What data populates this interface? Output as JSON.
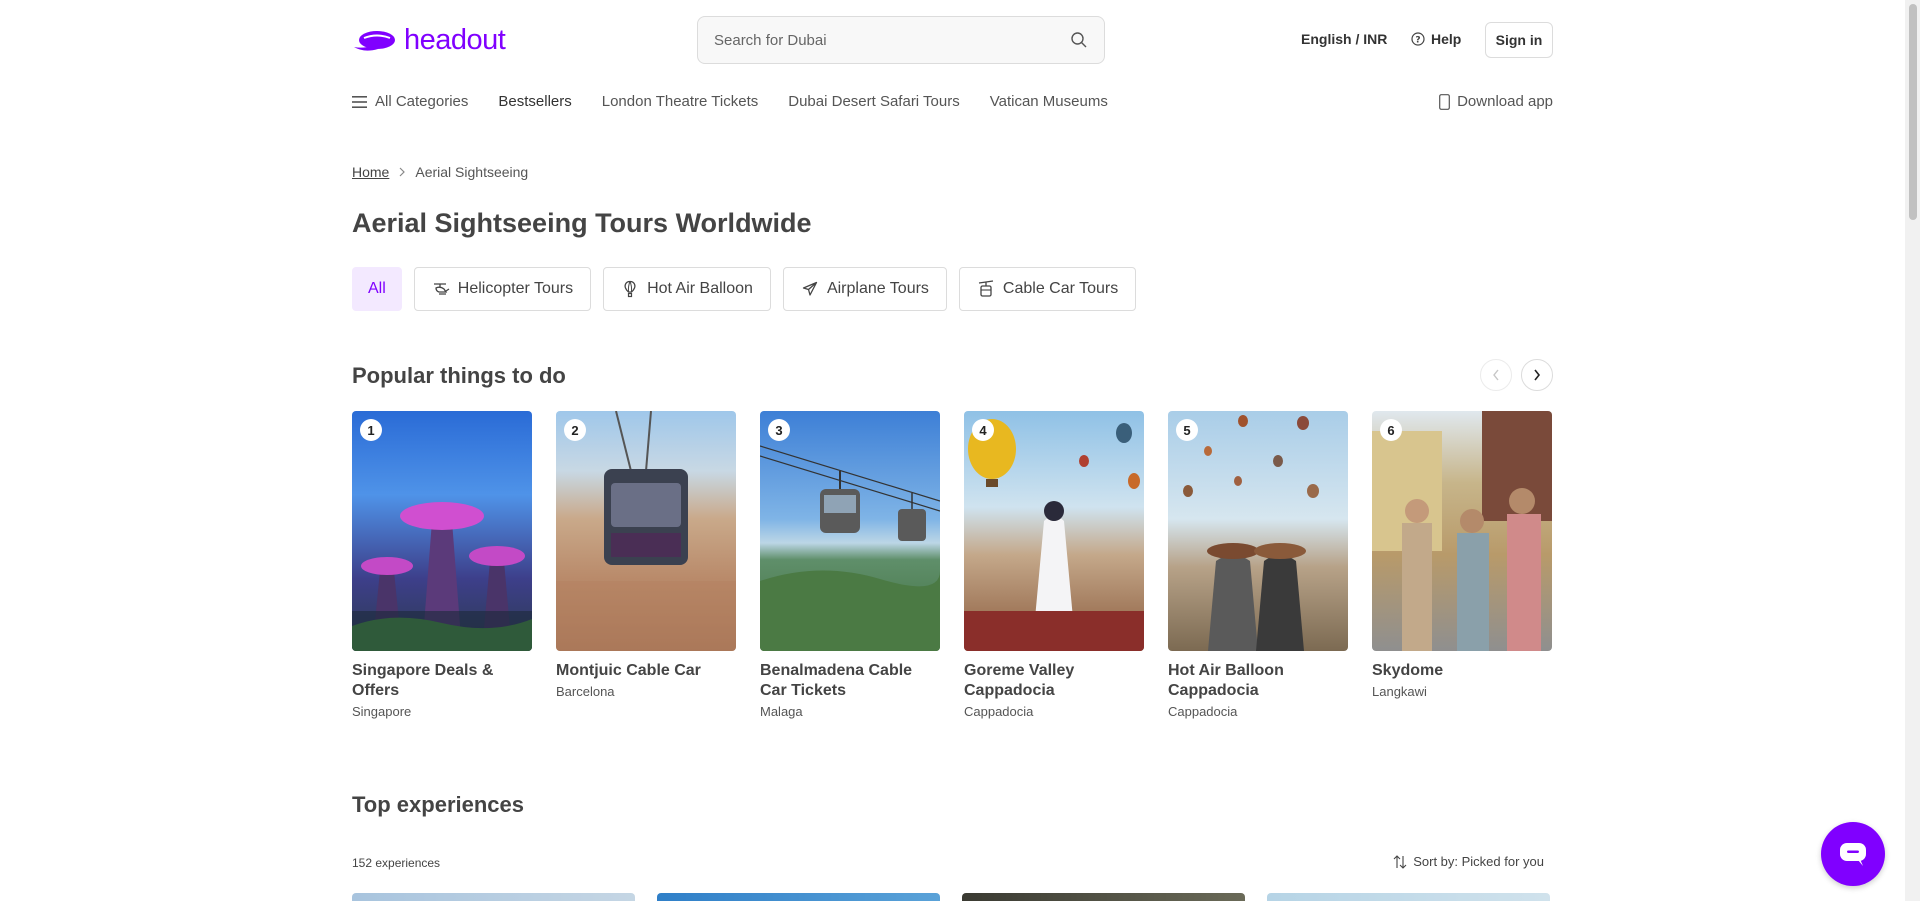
{
  "header": {
    "logo_text": "headout",
    "search_placeholder": "Search for Dubai",
    "language_currency": "English / INR",
    "help_label": "Help",
    "signin_label": "Sign in",
    "brand_color": "#8000ff"
  },
  "nav": {
    "items": [
      {
        "label": "All Categories",
        "icon": "hamburger-icon"
      },
      {
        "label": "Bestsellers"
      },
      {
        "label": "London Theatre Tickets"
      },
      {
        "label": "Dubai Desert Safari Tours"
      },
      {
        "label": "Vatican Museums"
      }
    ],
    "download_label": "Download app"
  },
  "breadcrumb": {
    "home": "Home",
    "current": "Aerial Sightseeing"
  },
  "page_title": "Aerial Sightseeing Tours Worldwide",
  "filters": [
    {
      "label": "All",
      "active": true
    },
    {
      "label": "Helicopter Tours",
      "icon": "helicopter-icon"
    },
    {
      "label": "Hot Air Balloon",
      "icon": "balloon-icon"
    },
    {
      "label": "Airplane Tours",
      "icon": "airplane-icon"
    },
    {
      "label": "Cable Car Tours",
      "icon": "cable-car-icon"
    }
  ],
  "popular": {
    "title": "Popular things to do",
    "cards": [
      {
        "rank": "1",
        "title": "Singapore Deals & Offers",
        "location": "Singapore"
      },
      {
        "rank": "2",
        "title": "Montjuic Cable Car",
        "location": "Barcelona"
      },
      {
        "rank": "3",
        "title": "Benalmadena Cable Car Tickets",
        "location": "Malaga"
      },
      {
        "rank": "4",
        "title": "Goreme Valley Cappadocia",
        "location": "Cappadocia"
      },
      {
        "rank": "5",
        "title": "Hot Air Balloon Cappadocia",
        "location": "Cappadocia"
      },
      {
        "rank": "6",
        "title": "Skydome",
        "location": "Langkawi"
      }
    ]
  },
  "top_experiences": {
    "title": "Top experiences",
    "count": "152 experiences",
    "sort_label": "Sort by: Picked for you"
  }
}
